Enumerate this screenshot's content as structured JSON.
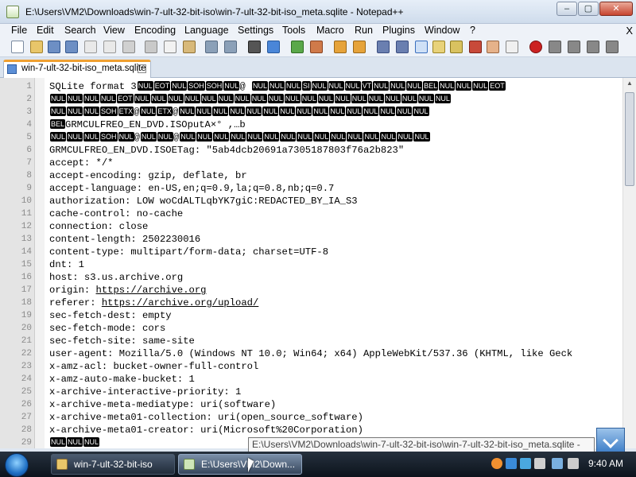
{
  "window": {
    "title": "E:\\Users\\VM2\\Downloads\\win-7-ult-32-bit-iso\\win-7-ult-32-bit-iso_meta.sqlite - Notepad++",
    "min_label": "–",
    "max_label": "▢",
    "close_label": "✕"
  },
  "menu": {
    "items": [
      "File",
      "Edit",
      "Search",
      "View",
      "Encoding",
      "Language",
      "Settings",
      "Tools",
      "Macro",
      "Run",
      "Plugins",
      "Window",
      "?"
    ],
    "close_label": "X"
  },
  "tab": {
    "label": "win-7-ult-32-bit-iso_meta.sqlite",
    "close_label": "x"
  },
  "editor": {
    "line_numbers": [
      "1",
      "2",
      "3",
      "4",
      "5",
      "6",
      "7",
      "8",
      "9",
      "10",
      "11",
      "12",
      "13",
      "14",
      "15",
      "16",
      "17",
      "18",
      "19",
      "20",
      "21",
      "22",
      "23",
      "24",
      "25",
      "26",
      "27",
      "28",
      "29"
    ],
    "line_1_prefix": "SQLite format 3",
    "line_6": "GRMCULFREO_EN_DVD.ISOETag: \"5ab4dcb20691a7305187803f76a2b823\"",
    "line_4_text": "GRMCULFREO_EN_DVD.ISOputA×° ,…b",
    "lines_text": [
      "accept: */*",
      "accept-encoding: gzip, deflate, br",
      "accept-language: en-US,en;q=0.9,la;q=0.8,nb;q=0.7",
      "authorization: LOW woCdALTLqbYK7giC:REDACTED_BY_IA_S3",
      "cache-control: no-cache",
      "connection: close",
      "content-length: 2502230016",
      "content-type: multipart/form-data; charset=UTF-8",
      "dnt: 1",
      "host: s3.us.archive.org"
    ],
    "origin_label": "origin: ",
    "origin_url": "https://archive.org",
    "referer_label": "referer: ",
    "referer_url": "https://archive.org/upload/",
    "lines_text_2": [
      "sec-fetch-dest: empty",
      "sec-fetch-mode: cors",
      "sec-fetch-site: same-site",
      "user-agent: Mozilla/5.0 (Windows NT 10.0; Win64; x64) AppleWebKit/537.36 (KHTML, like Geck",
      "x-amz-acl: bucket-owner-full-control",
      "x-amz-auto-make-bucket: 1",
      "x-archive-interactive-priority: 1",
      "x-archive-meta-mediatype: uri(software)",
      "x-archive-meta01-collection: uri(open_source_software)",
      "x-archive-meta01-creator: uri(Microsoft%20Corporation)"
    ],
    "control_chars": {
      "NUL": "NUL",
      "EOT": "EOT",
      "SOH": "SOH",
      "SI": "SI",
      "VT": "VT",
      "BEL": "BEL",
      "ETX": "ETX"
    }
  },
  "tooltip": {
    "text": "E:\\Users\\VM2\\Downloads\\win-7-ult-32-bit-iso\\win-7-ult-32-bit-iso_meta.sqlite -"
  },
  "taskbar": {
    "task1_label": "win-7-ult-32-bit-iso",
    "task2_label": "E:\\Users\\VM2\\Down...",
    "clock": "9:40 AM"
  },
  "colors": {
    "tab_accent": "#f0a030",
    "control_char_bg": "#000000",
    "taskbar_bg": "#0c131c"
  }
}
